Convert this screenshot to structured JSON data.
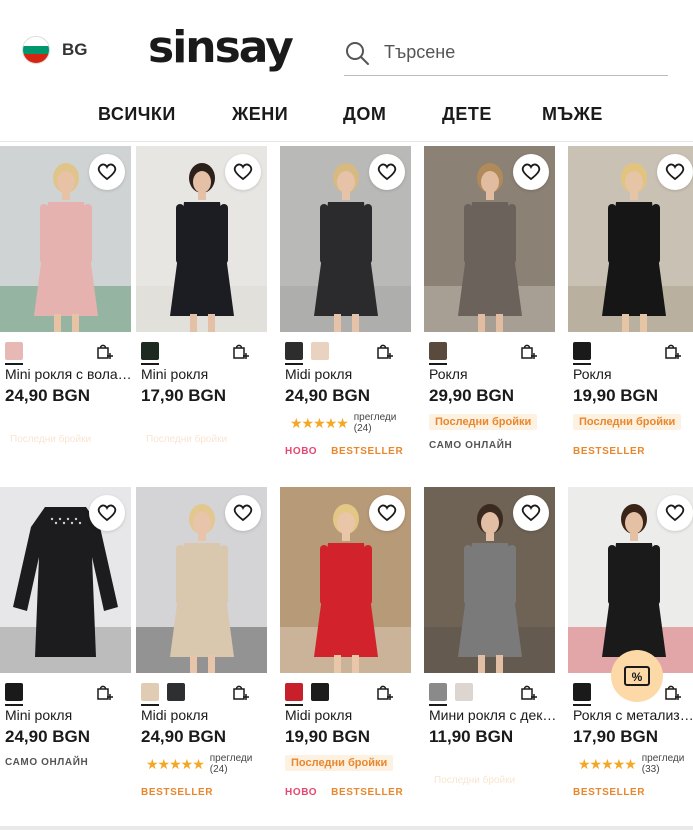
{
  "header": {
    "language": {
      "code": "BG",
      "flag_colors": [
        "#ffffff",
        "#00966e",
        "#d62612"
      ]
    },
    "logo": "sinsay",
    "search": {
      "placeholder": "Търсене"
    },
    "nav": [
      "ВСИЧКИ",
      "ЖЕНИ",
      "ДОМ",
      "ДЕТЕ",
      "МЪЖЕ"
    ]
  },
  "products": [
    {
      "name": "Mini рокля с вола…",
      "price": "24,90 BGN",
      "swatches": [
        "#e8b9b4"
      ],
      "faded_text": "Последни бройки",
      "photo": {
        "bg": "#cfd3d4",
        "figure": "#e6b2b0",
        "skin": "#e8c2a5",
        "hair": "#e0c58a",
        "accent": "#2c7a45"
      }
    },
    {
      "name": "Mini рокля",
      "price": "17,90 BGN",
      "swatches": [
        "#1d2a1f"
      ],
      "faded_text": "Последни бройки",
      "photo": {
        "bg": "#e8e6e2",
        "figure": "#1b1d22",
        "skin": "#e4c0a6",
        "hair": "#2b201a",
        "accent": "#d8d3ca"
      }
    },
    {
      "name": "Midi рокля",
      "price": "24,90 BGN",
      "swatches": [
        "#2d2d2d",
        "#e9d2c0"
      ],
      "rating": {
        "stars": "★★★★★",
        "label": "прегледи",
        "count": "(24)"
      },
      "tags": [
        "НОВО",
        "BESTSELLER"
      ],
      "photo": {
        "bg": "#b9b9b7",
        "figure": "#2b2b2e",
        "skin": "#e6c3a8",
        "hair": "#d7b982",
        "accent": "#9a9a98"
      }
    },
    {
      "name": "Рокля",
      "price": "29,90 BGN",
      "swatches": [
        "#5a4a3e"
      ],
      "last_items": "Последни бройки",
      "online": "САМО ОНЛАЙН",
      "photo": {
        "bg": "#8c8175",
        "figure": "#6a625b",
        "skin": "#e2bca0",
        "hair": "#b08a5a",
        "accent": "#d9d4cf"
      }
    },
    {
      "name": "Рокля",
      "price": "19,90 BGN",
      "swatches": [
        "#1a1a1a"
      ],
      "last_items": "Последни бройки",
      "tags": [
        "BESTSELLER"
      ],
      "photo": {
        "bg": "#c9c2b4",
        "figure": "#161616",
        "skin": "#e6c4a6",
        "hair": "#e2c47e",
        "accent": "#9c8f7c"
      }
    },
    {
      "name": "Mini рокля",
      "price": "24,90 BGN",
      "swatches": [
        "#1a1a1a"
      ],
      "online": "САМО ОНЛАЙН",
      "photo": {
        "bg": "#e7e7e9",
        "figure": "#1c1c1e",
        "skin": "#e7e7e9",
        "hair": "#e7e7e9",
        "accent": "#6d6d6d"
      }
    },
    {
      "name": "Midi рокля",
      "price": "24,90 BGN",
      "swatches": [
        "#e0ccb2",
        "#2e2f33"
      ],
      "rating": {
        "stars": "★★★★★",
        "label": "прегледи",
        "count": "(24)"
      },
      "tags": [
        "BESTSELLER"
      ],
      "photo": {
        "bg": "#d4d3d5",
        "figure": "#d9c8ad",
        "skin": "#e8c5aa",
        "hair": "#e2c88f",
        "accent": "#1e1e1e"
      }
    },
    {
      "name": "Midi рокля",
      "price": "19,90 BGN",
      "swatches": [
        "#c8202a",
        "#1c1c1c"
      ],
      "last_items": "Последни бройки",
      "tags": [
        "НОВО",
        "BESTSELLER"
      ],
      "photo": {
        "bg": "#b79a78",
        "figure": "#d2232c",
        "skin": "#eac6a9",
        "hair": "#e2c785",
        "accent": "#ede3d6"
      }
    },
    {
      "name": "Мини рокля с дек…",
      "price": "11,90 BGN",
      "swatches": [
        "#8a8a8a",
        "#ddd6d0"
      ],
      "faded_text": "Последни бройки",
      "photo": {
        "bg": "#6f6356",
        "figure": "#7a7a7a",
        "skin": "#e2bfa4",
        "hair": "#3b2a1f",
        "accent": "#524a42"
      }
    },
    {
      "name": "Рокля с метализ…",
      "price": "17,90 BGN",
      "swatches": [
        "#1a1a1a"
      ],
      "rating": {
        "stars": "★★★★★",
        "label": "прегледи",
        "count": "(33)"
      },
      "tags": [
        "BESTSELLER"
      ],
      "photo": {
        "bg": "#ececea",
        "figure": "#1a1a1a",
        "skin": "#e4c0a4",
        "hair": "#3a2418",
        "accent": "#d0262f"
      }
    }
  ],
  "promo_badge": {
    "label": "%"
  },
  "colors": {
    "accent_orange": "#e8872c",
    "new_pink": "#e4476f",
    "star": "#f5a623"
  }
}
